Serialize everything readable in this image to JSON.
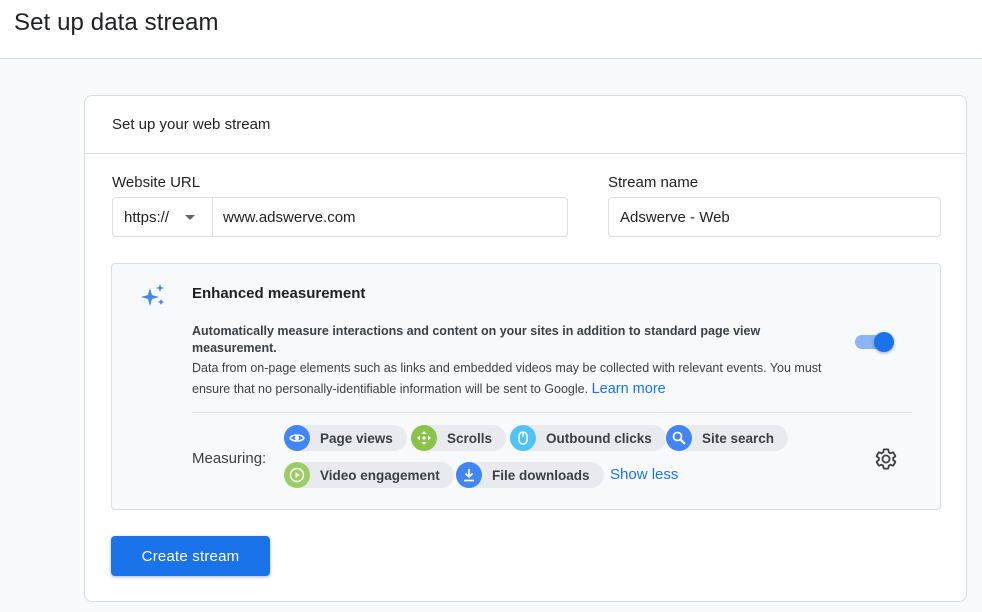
{
  "page": {
    "title": "Set up data stream"
  },
  "card": {
    "title": "Set up your web stream"
  },
  "website_url": {
    "label": "Website URL",
    "protocol": "https://",
    "value": "www.adswerve.com"
  },
  "stream_name": {
    "label": "Stream name",
    "value": "Adswerve - Web"
  },
  "enhanced_measurement": {
    "title": "Enhanced measurement",
    "description": "Automatically measure interactions and content on your sites in addition to standard page view measurement.",
    "note": "Data from on-page elements such as links and embedded videos may be collected with relevant events. You must ensure that no personally-identifiable information will be sent to Google.",
    "learn_more": "Learn more",
    "toggle_on": true,
    "measuring_label": "Measuring:",
    "chips": [
      {
        "label": "Page views",
        "icon": "eye-icon",
        "color": "#4285f4"
      },
      {
        "label": "Scrolls",
        "icon": "move-arrows-icon",
        "color": "#8bc34a"
      },
      {
        "label": "Outbound clicks",
        "icon": "mouse-icon",
        "color": "#4fc3f7"
      },
      {
        "label": "Site search",
        "icon": "search-icon",
        "color": "#4285f4"
      },
      {
        "label": "Video engagement",
        "icon": "play-icon",
        "color": "#9ccc65"
      },
      {
        "label": "File downloads",
        "icon": "download-icon",
        "color": "#4285f4"
      }
    ],
    "show_less": "Show less"
  },
  "actions": {
    "create_label": "Create stream"
  },
  "colors": {
    "accent": "#1a73e8",
    "border": "#dadce0",
    "background": "#f8f9fa"
  }
}
